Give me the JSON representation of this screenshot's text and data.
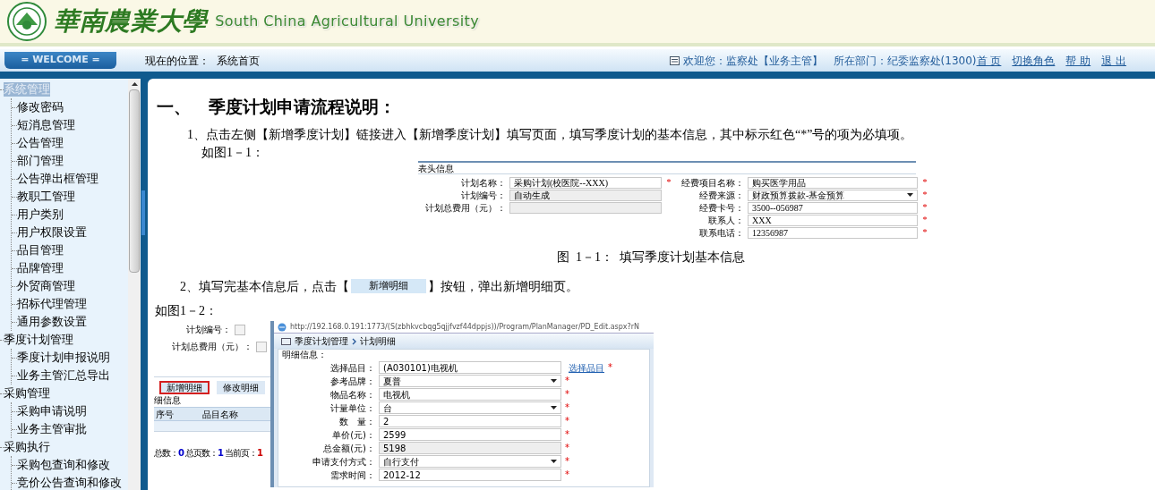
{
  "header": {
    "logo_cn": "華南農業大學",
    "logo_en": "South China Agricultural University"
  },
  "navbar": {
    "welcome": "= WELCOME =",
    "location_label": "现在的位置：",
    "location": "系统首页",
    "user_label": "欢迎您：",
    "user": "监察处【业务主管】",
    "dept_label": "所在部门：",
    "dept": "纪委监察处(1300)",
    "links": [
      "首 页",
      "切换角色",
      "帮 助",
      "退 出"
    ]
  },
  "sidebar": {
    "items": [
      {
        "label": "系统管理",
        "selected": true,
        "children": [
          {
            "label": "修改密码",
            "selected": false
          },
          {
            "label": "短消息管理",
            "selected": false
          },
          {
            "label": "公告管理",
            "selected": false
          },
          {
            "label": "部门管理",
            "selected": false
          },
          {
            "label": "公告弹出框管理",
            "selected": false
          },
          {
            "label": "教职工管理",
            "selected": false
          },
          {
            "label": "用户类别",
            "selected": false
          },
          {
            "label": "用户权限设置",
            "selected": false
          },
          {
            "label": "品目管理",
            "selected": false
          },
          {
            "label": "品牌管理",
            "selected": false
          },
          {
            "label": "外贸商管理",
            "selected": false
          },
          {
            "label": "招标代理管理",
            "selected": false
          },
          {
            "label": "通用参数设置",
            "selected": false
          }
        ]
      },
      {
        "label": "季度计划管理",
        "selected": false,
        "children": [
          {
            "label": "季度计划申报说明",
            "selected": false
          },
          {
            "label": "业务主管汇总导出",
            "selected": false
          }
        ]
      },
      {
        "label": "采购管理",
        "selected": false,
        "children": [
          {
            "label": "采购申请说明",
            "selected": false
          },
          {
            "label": "业务主管审批",
            "selected": false
          }
        ]
      },
      {
        "label": "采购执行",
        "selected": false,
        "children": [
          {
            "label": "采购包查询和修改",
            "selected": false
          },
          {
            "label": "竞价公告查询和修改",
            "selected": false
          }
        ]
      }
    ]
  },
  "content": {
    "required_mark": "*",
    "heading_number": "一、",
    "heading": "季度计划申请流程说明：",
    "step1": "1、点击左侧【新增季度计划】链接进入【新增季度计划】填写页面，填写季度计划的基本信息，其中标示红色“*”号的项为必填项。",
    "ref1": "如图1－1：",
    "figure1": {
      "legend": "表头信息",
      "left": [
        {
          "label": "计划名称：",
          "value": "采购计划(校医院--XXX)",
          "kind": "text",
          "required": true
        },
        {
          "label": "计划编号：",
          "value": "自动生成",
          "kind": "readonly",
          "required": false
        },
        {
          "label": "计划总费用（元）：",
          "kind": "readonly",
          "required": false
        }
      ],
      "right": [
        {
          "label": "经费项目名称：",
          "value": "购买医学用品",
          "kind": "text",
          "required": true
        },
        {
          "label": "经费来源：",
          "value": "财政预算拨款-基金预算",
          "kind": "select",
          "required": true
        },
        {
          "label": "经费卡号：",
          "value": "3500--056987",
          "kind": "text",
          "required": true
        },
        {
          "label": "联系人：",
          "value": "XXX",
          "kind": "text",
          "required": true
        },
        {
          "label": "联系电话：",
          "value": "12356987",
          "kind": "text",
          "required": true
        }
      ]
    },
    "caption1": "图  1－1：  填写季度计划基本信息",
    "step2_before": "2、填写完基本信息后，点击【",
    "step2_button": "新增明细",
    "step2_after": "】按钮，弹出新增明细页。",
    "ref2": "如图1－2：",
    "figure2": {
      "page": {
        "fields": [
          "计划编号：",
          "计划总费用（元）："
        ],
        "buttons": [
          {
            "label": "新增明细",
            "selected": true
          },
          {
            "label": "修改明细",
            "selected": false
          }
        ],
        "legend": "细信息",
        "columns": [
          "序号",
          "品目名称"
        ],
        "pager": [
          {
            "label": "总数：",
            "value": "0",
            "color": "#0000cc"
          },
          {
            "label": "总页数：",
            "value": "1",
            "color": "#0000cc"
          },
          {
            "label": "当前页：",
            "value": "1",
            "color": "#cc0000"
          }
        ]
      },
      "popup": {
        "url": "http://192.168.0.191:1773/(S(zbhkvcbqg5qjjfvzf44dppjs))/Program/PlanManager/PD_Edit.aspx?rN",
        "breadcrumb": [
          "季度计划管理",
          "计划明细"
        ],
        "legend": "明细信息：",
        "fields": [
          {
            "label": "选择品目：",
            "value": "(A030101)电视机",
            "kind": "text",
            "link": "选择品目",
            "required": true
          },
          {
            "label": "参考品牌：",
            "value": "夏普",
            "kind": "select",
            "required": true
          },
          {
            "label": "物品名称：",
            "value": "电视机",
            "kind": "text",
            "required": true
          },
          {
            "label": "计量单位：",
            "value": "台",
            "kind": "select",
            "required": true
          },
          {
            "label": "数　量：",
            "value": "2",
            "kind": "text",
            "required": true
          },
          {
            "label": "单价(元)：",
            "value": "2599",
            "kind": "text",
            "required": true
          },
          {
            "label": "总金额(元)：",
            "value": "5198",
            "kind": "readonly",
            "required": true
          },
          {
            "label": "申请支付方式：",
            "value": "自行支付",
            "kind": "select",
            "required": true
          },
          {
            "label": "需求时间：",
            "value": "2012-12",
            "kind": "text",
            "required": true
          }
        ]
      }
    }
  }
}
